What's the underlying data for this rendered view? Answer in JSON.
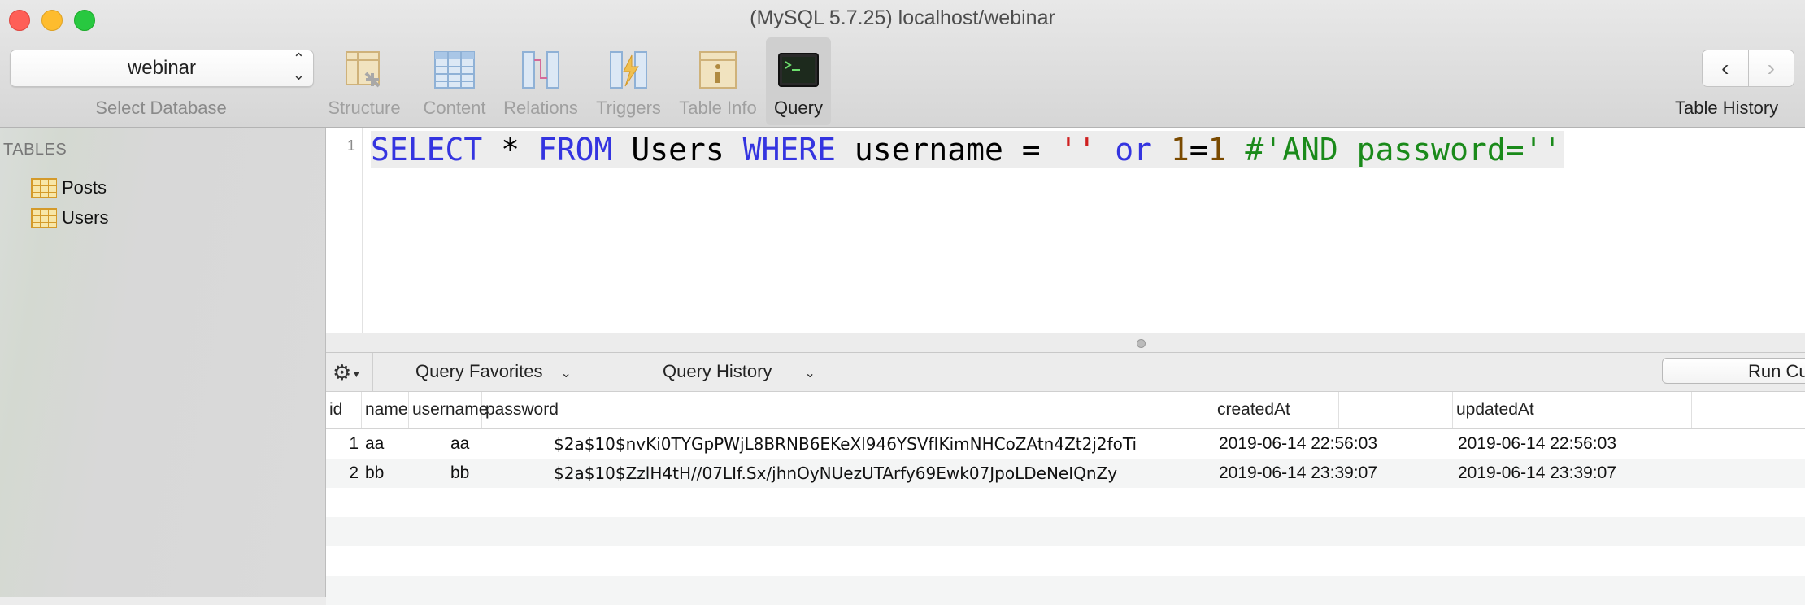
{
  "window": {
    "title": "(MySQL 5.7.25) localhost/webinar"
  },
  "toolbar": {
    "database": {
      "value": "webinar",
      "label": "Select Database"
    },
    "tabs": [
      {
        "label": "Structure",
        "icon": "structure-icon"
      },
      {
        "label": "Content",
        "icon": "content-icon"
      },
      {
        "label": "Relations",
        "icon": "relations-icon"
      },
      {
        "label": "Triggers",
        "icon": "triggers-icon"
      },
      {
        "label": "Table Info",
        "icon": "table-info-icon"
      },
      {
        "label": "Query",
        "icon": "terminal-icon",
        "active": true
      }
    ],
    "history_label": "Table History"
  },
  "sidebar": {
    "header": "TABLES",
    "items": [
      {
        "label": "Posts"
      },
      {
        "label": "Users"
      }
    ]
  },
  "editor": {
    "line_number": "1",
    "tokens": {
      "t1": "SELECT",
      "t2": " * ",
      "t3": "FROM",
      "t4": " Users ",
      "t5": "WHERE",
      "t6": " username = ",
      "t7": "''",
      "t8": " ",
      "t9": "or",
      "t10": " ",
      "t11": "1",
      "t12": "=",
      "t13": "1",
      "t14": " ",
      "t15": "#'AND password=''"
    }
  },
  "query_bar": {
    "favorites": "Query Favorites",
    "history": "Query History",
    "run": "Run Cu"
  },
  "results": {
    "columns": [
      "id",
      "name",
      "username",
      "password",
      "createdAt",
      "updatedAt"
    ],
    "rows": [
      {
        "id": "1",
        "name": "aa",
        "username": "aa",
        "password": "$2a$10$nvKi0TYGpPWjL8BRNB6EKeXl946YSVfIKimNHCoZAtn4Zt2j2foTi",
        "createdAt": "2019-06-14 22:56:03",
        "updatedAt": "2019-06-14 22:56:03"
      },
      {
        "id": "2",
        "name": "bb",
        "username": "bb",
        "password": "$2a$10$ZzlH4tH//07LIf.Sx/jhnOyNUezUTArfy69Ewk07JpoLDeNeIQnZy",
        "createdAt": "2019-06-14 23:39:07",
        "updatedAt": "2019-06-14 23:39:07"
      }
    ]
  },
  "colors": {
    "keyword": "#3434e0",
    "string": "#cf2020",
    "number": "#7a4a00",
    "comment": "#1a8a1a"
  }
}
